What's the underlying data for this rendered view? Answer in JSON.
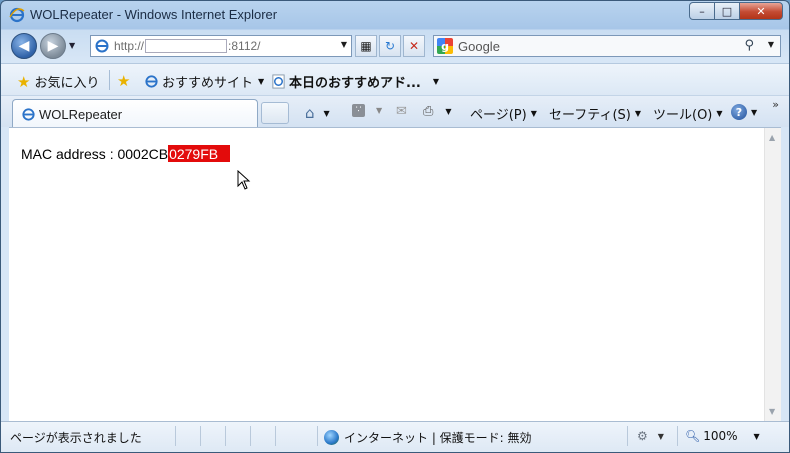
{
  "window": {
    "title": "WOLRepeater - Windows Internet Explorer",
    "controls": {
      "minimize": "–",
      "maximize": "□",
      "close": "✕"
    }
  },
  "address_bar": {
    "prefix": "http://",
    "suffix": ":8112/",
    "nav_back_icon": "back-arrow-icon",
    "nav_forward_icon": "forward-arrow-icon"
  },
  "search": {
    "provider": "Google",
    "icon": "search-icon"
  },
  "favorites_bar": {
    "favorites_label": "お気に入り",
    "items": [
      {
        "label": "おすすめサイト"
      },
      {
        "label": "本日のおすすめアド..."
      }
    ]
  },
  "tabs": [
    {
      "label": "WOLRepeater"
    }
  ],
  "command_bar": {
    "page": "ページ(P)",
    "safety": "セーフティ(S)",
    "tools": "ツール(O)",
    "help": "?"
  },
  "page": {
    "mac_label": "MAC address : ",
    "mac_plain": "0002CB",
    "mac_highlight": "0279FB",
    "highlight_color": "#e30b0b"
  },
  "status_bar": {
    "status_text": "ページが表示されました",
    "zone": "インターネット | 保護モード: 無効",
    "zoom": "100%"
  }
}
